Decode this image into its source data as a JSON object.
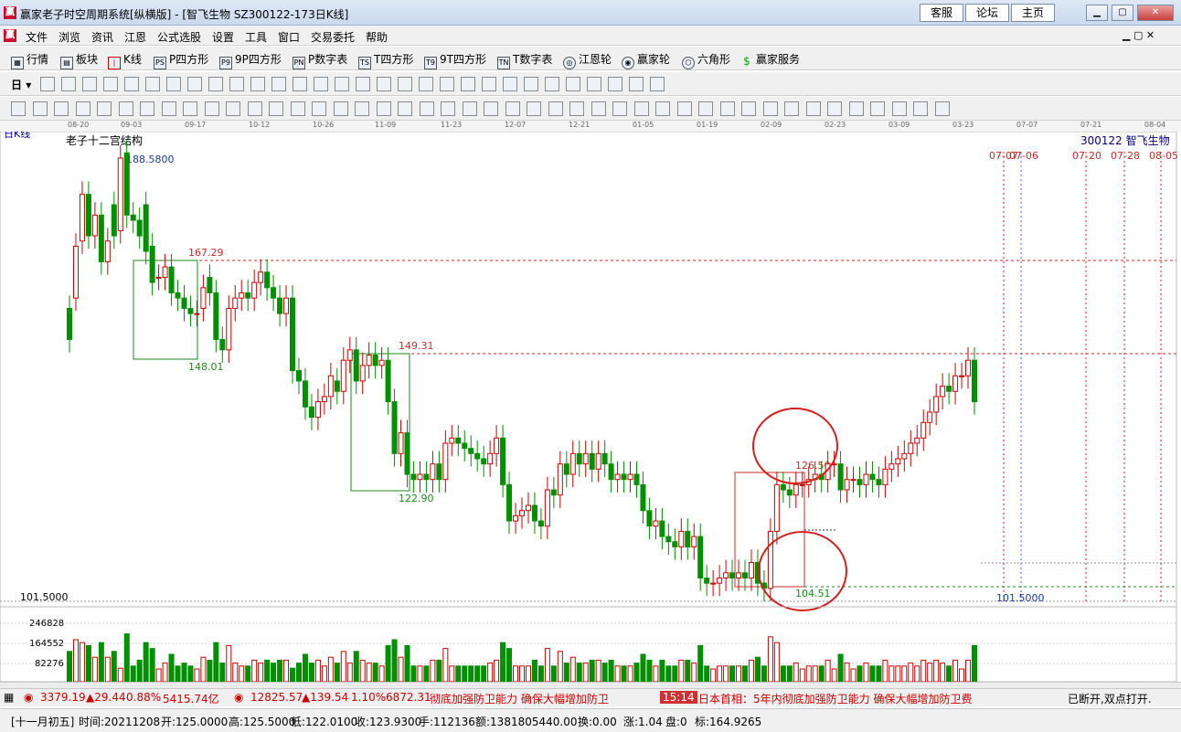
{
  "window": {
    "title": "赢家老子时空周期系统[纵横版] - [智飞生物  SZ300122-173日K线]",
    "buttons": [
      "客服",
      "论坛",
      "主页"
    ]
  },
  "menu": [
    "文件",
    "浏览",
    "资讯",
    "江恩",
    "公式选股",
    "设置",
    "工具",
    "窗口",
    "交易委托",
    "帮助"
  ],
  "toolbar1": [
    "行情",
    "板块",
    "K线",
    "P四方形",
    "9P四方形",
    "P数字表",
    "T四方形",
    "9T四方形",
    "T数字表",
    "江恩轮",
    "赢家轮",
    "六角形",
    "赢家服务"
  ],
  "toolbar1_icons": [
    "PS",
    "P9",
    "PN",
    "TS",
    "T9",
    "TN"
  ],
  "toolbar2_first": "日",
  "dates": [
    "08-20",
    "09-03",
    "09-17",
    "10-12",
    "10-26",
    "11-09",
    "11-23",
    "12-07",
    "12-21",
    "01-05",
    "01-19",
    "02-09",
    "02-23",
    "03-09",
    "03-23",
    "07-07",
    "07-21",
    "08-04"
  ],
  "chart": {
    "period": "日K线",
    "indicator_name": "老子十二宫结构",
    "stock": "300122  智飞生物",
    "high_label": "188.5800",
    "low_label": "101.5000",
    "low_axis": "101.5000",
    "levels": [
      "167.29",
      "148.01",
      "149.31",
      "122.90",
      "126.50",
      "104.51"
    ],
    "future_dates": [
      "07-07",
      "07-06",
      "07-20",
      "07-28",
      "08-05"
    ],
    "vol_axis": [
      "246828",
      "164552",
      "82276"
    ],
    "colors": {
      "up": "#d00000",
      "down": "#009000",
      "box": "#1a8a1a",
      "dash": "#cc2a2a",
      "circle": "#d42020"
    }
  },
  "chart_data": {
    "type": "candlestick",
    "ylim": [
      101.5,
      188.58
    ],
    "open": [
      158,
      160,
      171,
      180,
      172,
      176,
      167,
      178,
      173,
      188,
      176,
      175,
      178,
      170,
      164,
      164,
      166,
      161,
      160,
      158,
      157,
      158,
      164,
      161,
      152,
      150,
      158,
      160,
      161,
      160,
      163,
      165,
      162,
      160,
      157,
      160,
      146,
      144,
      139,
      137,
      140,
      141,
      144,
      142,
      148,
      150,
      144,
      147,
      149,
      147,
      148,
      140,
      130,
      134,
      126,
      125,
      126,
      125,
      128,
      125,
      132,
      133,
      132,
      131,
      130,
      129,
      128,
      130,
      133,
      124,
      117,
      118,
      119,
      120,
      117,
      116,
      123,
      122,
      128,
      126,
      130,
      128,
      130,
      127,
      130,
      128,
      125,
      126,
      125,
      126,
      124,
      119,
      116,
      117,
      114,
      113,
      112,
      115,
      112,
      114,
      106,
      105,
      105,
      106,
      107,
      106,
      107,
      106,
      109,
      105,
      104,
      115,
      124,
      123,
      122,
      124,
      124,
      125,
      126,
      125,
      128,
      128,
      123,
      125,
      125,
      124,
      126,
      125,
      124,
      127,
      128,
      129,
      130,
      132,
      133,
      136,
      138,
      141,
      143,
      142,
      145,
      145,
      148
    ],
    "close": [
      152,
      170,
      180,
      172,
      176,
      167,
      171,
      172,
      187,
      176,
      175,
      172,
      169,
      163,
      164,
      166,
      161,
      160,
      158,
      157,
      157,
      162,
      161,
      152,
      150,
      158,
      160,
      161,
      160,
      163,
      165,
      162,
      160,
      157,
      160,
      146,
      144,
      139,
      137,
      140,
      141,
      145,
      142,
      148,
      150,
      144,
      147,
      149,
      147,
      148,
      140,
      130,
      134,
      126,
      125,
      126,
      125,
      128,
      125,
      132,
      133,
      132,
      131,
      130,
      129,
      128,
      130,
      133,
      124,
      117,
      118,
      119,
      120,
      117,
      116,
      123,
      122,
      128,
      126,
      130,
      128,
      130,
      127,
      130,
      128,
      125,
      126,
      125,
      126,
      124,
      119,
      116,
      117,
      114,
      113,
      112,
      115,
      112,
      114,
      106,
      105,
      105,
      106,
      107,
      106,
      107,
      106,
      109,
      105,
      104,
      115,
      124,
      123,
      122,
      124,
      124,
      125,
      126,
      125,
      128,
      128,
      123,
      125,
      125,
      124,
      126,
      125,
      124,
      127,
      128,
      129,
      130,
      132,
      133,
      136,
      138,
      141,
      143,
      142,
      145,
      145,
      148,
      140
    ],
    "note_low": "101.5000"
  },
  "tickers": {
    "sh": "3379.19",
    "sh_chg": "▲29.44",
    "sh_pct": "0.88%",
    "sh_amt": "5415.74亿",
    "hk": "12825.57",
    "hk_chg": "▲139.54",
    "hk_pct": "1.10%",
    "hk_amt": "6872.31",
    "news1": "彻底加强防卫能力  确保大幅增加防卫",
    "time": "15:14",
    "news2": "日本首相：5年内彻底加强防卫能力  确保大幅增加防卫费",
    "conn": "已断开,双点打开."
  },
  "status": {
    "lunar": "[十一月初五]",
    "date": "时间:20211208",
    "open": "开:125.0000",
    "high": "高:125.5000",
    "low": "低:122.0100",
    "close": "收:123.9300",
    "hand": "手:112136",
    "amount": "额:1381805440.00",
    "turnover": "换:0.00",
    "change": "涨:1.04",
    "disk": "盘:0",
    "mark": "标:164.9265"
  }
}
